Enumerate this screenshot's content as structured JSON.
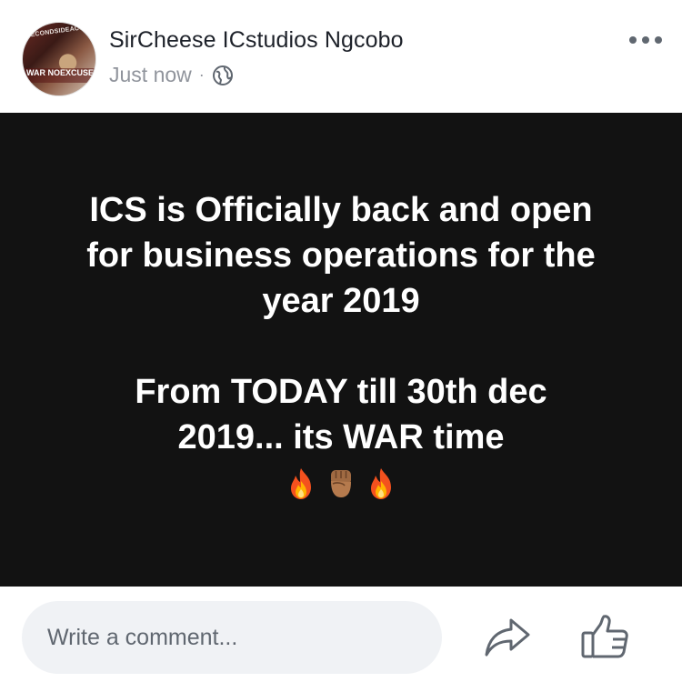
{
  "post": {
    "author": "SirCheese ICstudios Ngcobo",
    "timestamp": "Just now",
    "separator": "·",
    "privacy_icon": "globe-icon",
    "avatar": {
      "top_text": "#SECONDSIDEACTION",
      "bottom_text": "WAR NOEXCUSE"
    },
    "more_icon": "more-options-icon",
    "body": {
      "line1": "ICS is Officially back and open",
      "line2": "for business operations for the",
      "line3": "year 2019",
      "line4": "From TODAY till 30th dec",
      "line5": "2019... its WAR time"
    },
    "emojis": [
      "fire-icon",
      "raised-fist-icon",
      "fire-icon"
    ],
    "background_color": "#121212",
    "text_color": "#ffffff"
  },
  "footer": {
    "comment_placeholder": "Write a comment...",
    "share_icon": "share-icon",
    "like_icon": "like-icon"
  }
}
